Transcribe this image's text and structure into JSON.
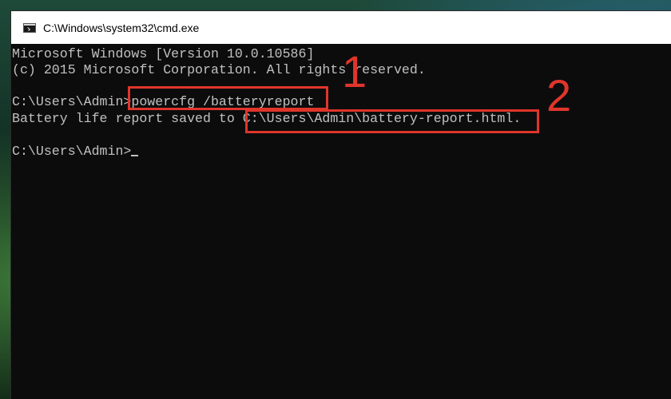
{
  "window": {
    "title": "C:\\Windows\\system32\\cmd.exe"
  },
  "console": {
    "lines": [
      "Microsoft Windows [Version 10.0.10586]",
      "(c) 2015 Microsoft Corporation. All rights reserved.",
      "",
      "C:\\Users\\Admin>powercfg /batteryreport",
      "Battery life report saved to C:\\Users\\Admin\\battery-report.html.",
      "",
      "C:\\Users\\Admin>"
    ],
    "text_color": "#c0c0c0",
    "background_color": "#0c0c0c"
  },
  "annotations": {
    "color": "#e0352b",
    "markers": [
      {
        "label": "1",
        "target": "powercfg /batteryreport"
      },
      {
        "label": "2",
        "target": "C:\\Users\\Admin\\battery-report.html."
      }
    ]
  },
  "icons": {
    "app_icon": "cmd-console-icon"
  }
}
